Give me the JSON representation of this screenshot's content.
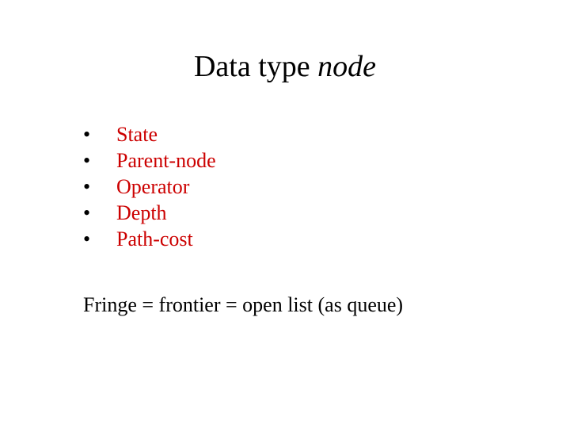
{
  "title": {
    "plain": "Data type ",
    "italic": "node"
  },
  "bullets": [
    "State",
    "Parent-node",
    "Operator",
    "Depth",
    "Path-cost"
  ],
  "footer": "Fringe = frontier = open list (as queue)"
}
